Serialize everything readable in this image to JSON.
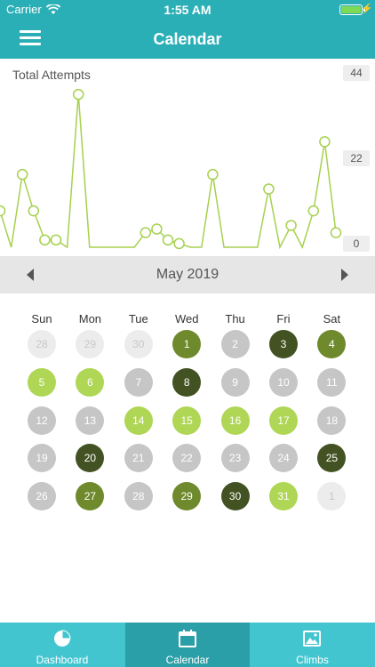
{
  "status_bar": {
    "carrier": "Carrier",
    "time": "1:55 AM"
  },
  "header": {
    "title": "Calendar"
  },
  "chart_data": {
    "type": "line",
    "title": "Total Attempts",
    "y_ticks": [
      "44",
      "22",
      "0"
    ],
    "ylim": [
      0,
      44
    ],
    "color": "#a6d14e",
    "points": [
      {
        "x": 0,
        "y": 10
      },
      {
        "x": 1,
        "y": 0
      },
      {
        "x": 2,
        "y": 20
      },
      {
        "x": 3,
        "y": 10
      },
      {
        "x": 4,
        "y": 2
      },
      {
        "x": 5,
        "y": 2
      },
      {
        "x": 6,
        "y": 0
      },
      {
        "x": 7,
        "y": 42
      },
      {
        "x": 8,
        "y": 0
      },
      {
        "x": 9,
        "y": 0
      },
      {
        "x": 10,
        "y": 0
      },
      {
        "x": 11,
        "y": 0
      },
      {
        "x": 12,
        "y": 0
      },
      {
        "x": 13,
        "y": 4
      },
      {
        "x": 14,
        "y": 5
      },
      {
        "x": 15,
        "y": 2
      },
      {
        "x": 16,
        "y": 1
      },
      {
        "x": 17,
        "y": 0
      },
      {
        "x": 18,
        "y": 0
      },
      {
        "x": 19,
        "y": 20
      },
      {
        "x": 20,
        "y": 0
      },
      {
        "x": 21,
        "y": 0
      },
      {
        "x": 22,
        "y": 0
      },
      {
        "x": 23,
        "y": 0
      },
      {
        "x": 24,
        "y": 16
      },
      {
        "x": 25,
        "y": 0
      },
      {
        "x": 26,
        "y": 6
      },
      {
        "x": 27,
        "y": 0
      },
      {
        "x": 28,
        "y": 10
      },
      {
        "x": 29,
        "y": 29
      },
      {
        "x": 30,
        "y": 4
      }
    ],
    "markers": [
      0,
      2,
      3,
      4,
      5,
      7,
      13,
      14,
      15,
      16,
      19,
      24,
      26,
      28,
      29,
      30
    ]
  },
  "calendar": {
    "month_label": "May 2019",
    "weekdays": [
      "Sun",
      "Mon",
      "Tue",
      "Wed",
      "Thu",
      "Fri",
      "Sat"
    ],
    "colors": {
      "none": "#c6c6c6",
      "low": "#afd655",
      "mid": "#6f8a2c",
      "high": "#425222",
      "outside": "#ececec"
    },
    "days": [
      {
        "label": "28",
        "level": "outside"
      },
      {
        "label": "29",
        "level": "outside"
      },
      {
        "label": "30",
        "level": "outside"
      },
      {
        "label": "1",
        "level": "mid"
      },
      {
        "label": "2",
        "level": "none"
      },
      {
        "label": "3",
        "level": "high"
      },
      {
        "label": "4",
        "level": "mid"
      },
      {
        "label": "5",
        "level": "low"
      },
      {
        "label": "6",
        "level": "low"
      },
      {
        "label": "7",
        "level": "none"
      },
      {
        "label": "8",
        "level": "high"
      },
      {
        "label": "9",
        "level": "none"
      },
      {
        "label": "10",
        "level": "none"
      },
      {
        "label": "11",
        "level": "none"
      },
      {
        "label": "12",
        "level": "none"
      },
      {
        "label": "13",
        "level": "none"
      },
      {
        "label": "14",
        "level": "low"
      },
      {
        "label": "15",
        "level": "low"
      },
      {
        "label": "16",
        "level": "low"
      },
      {
        "label": "17",
        "level": "low"
      },
      {
        "label": "18",
        "level": "none"
      },
      {
        "label": "19",
        "level": "none"
      },
      {
        "label": "20",
        "level": "high"
      },
      {
        "label": "21",
        "level": "none"
      },
      {
        "label": "22",
        "level": "none"
      },
      {
        "label": "23",
        "level": "none"
      },
      {
        "label": "24",
        "level": "none"
      },
      {
        "label": "25",
        "level": "high"
      },
      {
        "label": "26",
        "level": "none"
      },
      {
        "label": "27",
        "level": "mid"
      },
      {
        "label": "28",
        "level": "none"
      },
      {
        "label": "29",
        "level": "mid"
      },
      {
        "label": "30",
        "level": "high"
      },
      {
        "label": "31",
        "level": "low"
      },
      {
        "label": "1",
        "level": "outside"
      }
    ]
  },
  "tabbar": {
    "tabs": [
      {
        "label": "Dashboard",
        "icon": "pie-chart-icon"
      },
      {
        "label": "Calendar",
        "icon": "calendar-icon",
        "active": true
      },
      {
        "label": "Climbs",
        "icon": "image-icon"
      }
    ]
  }
}
